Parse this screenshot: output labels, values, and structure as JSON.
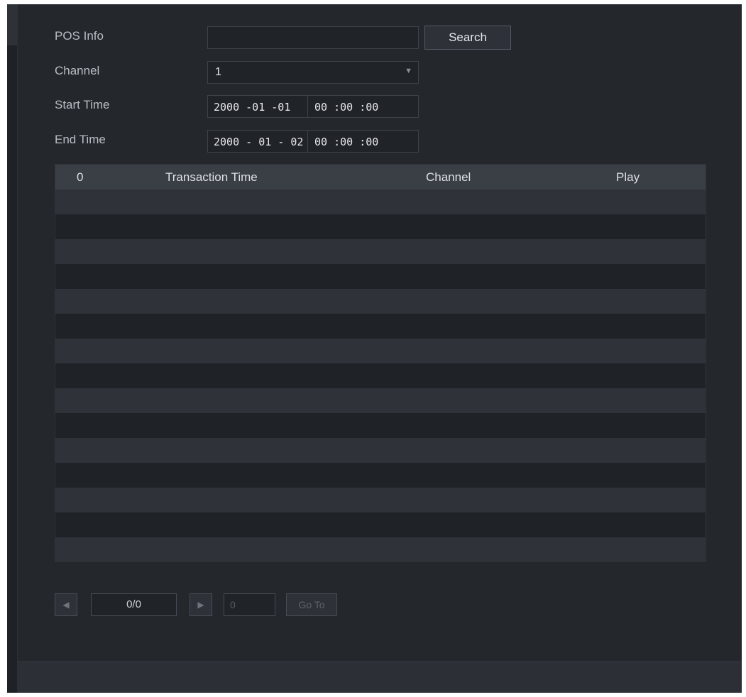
{
  "form": {
    "pos_info_label": "POS Info",
    "pos_info_value": "",
    "search_label": "Search",
    "channel_label": "Channel",
    "channel_value": "1",
    "start_time_label": "Start Time",
    "start_date": "2000 -01 -01",
    "start_clock": "00 :00 :00",
    "end_time_label": "End Time",
    "end_date": "2000 - 01 - 02",
    "end_clock": "00 :00 :00"
  },
  "table": {
    "columns": [
      "0",
      "Transaction Time",
      "Channel",
      "Play"
    ],
    "rows": []
  },
  "pager": {
    "prev_icon": "chevron-left-icon",
    "page_status": "0/0",
    "next_icon": "chevron-right-icon",
    "jump_value": "0",
    "goto_label": "Go To"
  }
}
